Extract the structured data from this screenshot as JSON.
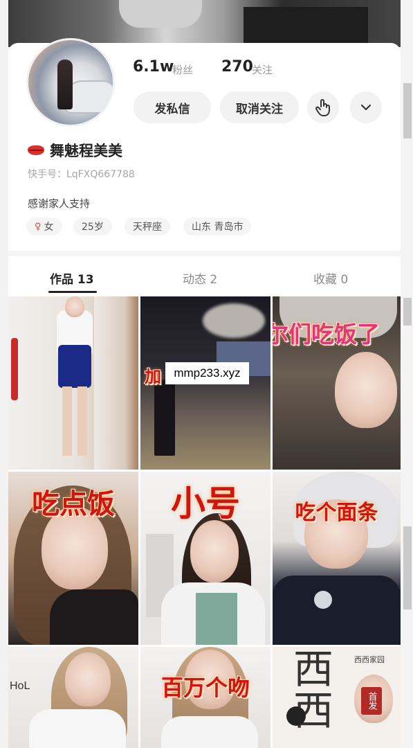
{
  "profile": {
    "followers_count": "6.1w",
    "followers_label": "粉丝",
    "following_count": "270",
    "following_label": "关注",
    "message_button": "发私信",
    "unfollow_button": "取消关注",
    "name": "舞魅程美美",
    "user_id": "快手号：LqFXQ667788",
    "bio": "感谢家人支持",
    "tags": [
      {
        "label": "女",
        "icon": "female-icon"
      },
      {
        "label": "25岁"
      },
      {
        "label": "天秤座"
      },
      {
        "label": "山东 青岛市"
      }
    ]
  },
  "tabs": [
    {
      "label": "作品 13",
      "active": true
    },
    {
      "label": "动态 2",
      "active": false
    },
    {
      "label": "收藏 0",
      "active": false
    }
  ],
  "videos": [
    {
      "caption": ""
    },
    {
      "caption": "加"
    },
    {
      "caption": "尔们吃饭了"
    },
    {
      "caption": "吃点饭"
    },
    {
      "caption": "小号"
    },
    {
      "caption": "吃个面条"
    },
    {
      "caption": ""
    },
    {
      "caption": "百万个吻"
    },
    {
      "caption": "西西",
      "badge": "首发",
      "sub": "西西家园"
    }
  ],
  "watermark": "mmp233.xyz",
  "icons": {
    "touch": "hand-pointer-icon",
    "more": "chevron-down-icon"
  },
  "colors": {
    "caption_red": "#d01414",
    "female_icon": "#e0433d"
  }
}
